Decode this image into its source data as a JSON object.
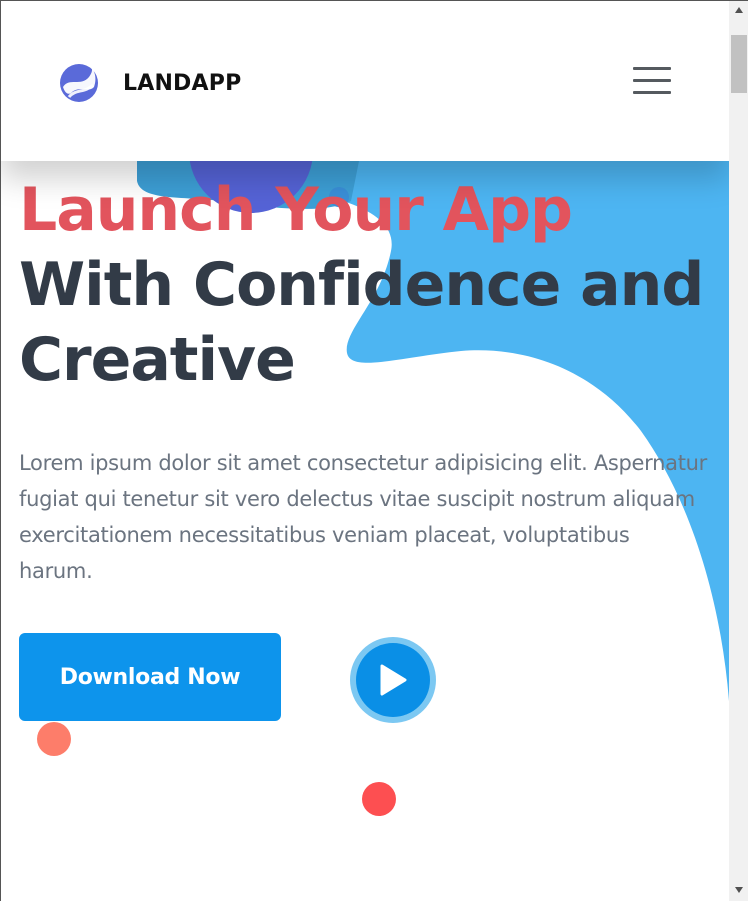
{
  "header": {
    "brand": "LANDAPP",
    "logo_icon": "landapp-logo-icon",
    "menu_icon": "hamburger-menu-icon"
  },
  "hero": {
    "title_accent": "Launch Your App",
    "title_rest": "With Confidence and Creative",
    "description": "Lorem ipsum dolor sit amet consectetur adipisicing elit. Aspernatur fugiat qui tenetur sit vero delectus vitae suscipit nostrum aliquam exercitationem necessitatibus veniam placeat, voluptatibus harum.",
    "download_label": "Download Now",
    "play_icon": "play-icon"
  },
  "colors": {
    "accent_red": "#e2545d",
    "heading_dark": "#323b47",
    "body_gray": "#6b7480",
    "primary_blue": "#0d94ec",
    "shape_blue": "#4db5f2",
    "shape_purple": "#5563d6",
    "dot_coral": "#fd7d6a",
    "dot_red": "#fd4f51"
  }
}
